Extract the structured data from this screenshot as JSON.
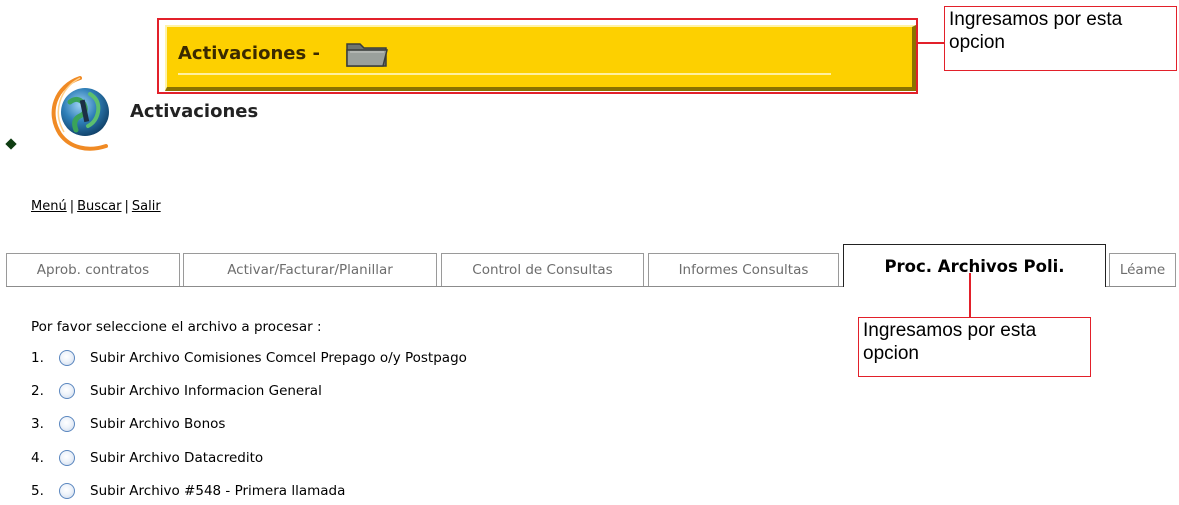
{
  "banner": {
    "title": "Activaciones -",
    "icon": "folder-icon",
    "color": "#fdd000"
  },
  "annotations": {
    "top": "Ingresamos por esta opcion",
    "tab": "Ingresamos por esta opcion",
    "color": "#e2202a"
  },
  "header": {
    "title": "Activaciones",
    "logo": "globe-logo-icon"
  },
  "nav": {
    "menu": "Menú",
    "search": "Buscar",
    "logout": "Salir",
    "separator": "|"
  },
  "tabs": [
    {
      "label": "Aprob. contratos",
      "active": false
    },
    {
      "label": "Activar/Facturar/Planillar",
      "active": false
    },
    {
      "label": "Control de Consultas",
      "active": false
    },
    {
      "label": "Informes Consultas",
      "active": false
    },
    {
      "label": "Proc. Archivos Poli.",
      "active": true
    },
    {
      "label": "Léame",
      "active": false
    }
  ],
  "form": {
    "prompt": "Por favor seleccione el archivo a procesar :",
    "options": [
      {
        "number": "1.",
        "label": "Subir Archivo Comisiones Comcel Prepago o/y Postpago",
        "selected": false
      },
      {
        "number": "2.",
        "label": "Subir Archivo Informacion General",
        "selected": false
      },
      {
        "number": "3.",
        "label": "Subir Archivo Bonos",
        "selected": false
      },
      {
        "number": "4.",
        "label": "Subir Archivo Datacredito",
        "selected": false
      },
      {
        "number": "5.",
        "label": "Subir Archivo #548 - Primera llamada",
        "selected": false
      }
    ]
  }
}
